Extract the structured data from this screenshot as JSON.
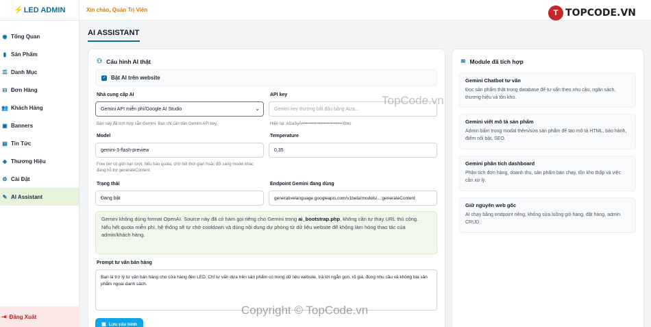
{
  "brand": {
    "bolt": "⚡",
    "name": "LED ADMIN"
  },
  "topbar": {
    "greeting": "Xin chào, Quản Trị Viên"
  },
  "logo": {
    "mark": "T",
    "text": "TOPCODE.VN"
  },
  "sidebar": {
    "items": [
      {
        "label": "Tổng Quan",
        "icon": "◉"
      },
      {
        "label": "Sản Phẩm",
        "icon": "▮"
      },
      {
        "label": "Danh Mục",
        "icon": "☰"
      },
      {
        "label": "Đơn Hàng",
        "icon": "⊟"
      },
      {
        "label": "Khách Hàng",
        "icon": "👥"
      },
      {
        "label": "Banners",
        "icon": "▣"
      },
      {
        "label": "Tin Tức",
        "icon": "▤"
      },
      {
        "label": "Thương Hiệu",
        "icon": "◈"
      },
      {
        "label": "Cài Đặt",
        "icon": "⚙"
      },
      {
        "label": "AI Assistant",
        "icon": "✎"
      }
    ],
    "logout": "Đăng Xuất"
  },
  "page": {
    "title": "AI ASSISTANT"
  },
  "config": {
    "heading": "Cấu hình AI thật",
    "enable_label": "Bật AI trên website",
    "provider": {
      "label": "Nhà cung cấp AI",
      "value": "Gemini API miễn phí/Google AI Studio",
      "hint": "Bản này đã tích hợp sẵn Gemini. Bạn chỉ cần dán Gemini API key."
    },
    "api_key": {
      "label": "API key",
      "placeholder": "Gemini key thường bắt đầu bằng Aiza...",
      "hint": "Hiện tại: AIzaSyA••••••••••••••••••••••••••••Xbks"
    },
    "model": {
      "label": "Model",
      "value": "gemini-3-flash-preview",
      "hint": "Free tier có giới hạn lượt. Nếu báo quota, chờ hết thời gian hoặc đổi sang model khác đang hỗ trợ generateContent."
    },
    "temperature": {
      "label": "Temperature",
      "value": "0,35"
    },
    "status": {
      "label": "Trạng thái",
      "value": "Đang bật"
    },
    "endpoint": {
      "label": "Endpoint Gemini đang dùng",
      "value": "generativelanguage.googleapis.com/v1beta/models/...:generateContent"
    },
    "alert": {
      "line1_pre": "Gemini không dùng format OpenAI. Source này đã có hàm gọi riêng cho Gemini trong ",
      "line1_bold": "ai_bootstrap.php",
      "line1_post": ", không cần tự thay URL thủ công.",
      "line2": "Nếu hết quota miễn phí, hệ thống sẽ tự chờ cooldown và dùng nội dung dự phòng từ dữ liệu website để không làm hỏng thao tác của admin/khách hàng."
    },
    "prompt": {
      "label": "Prompt tư vấn bán hàng",
      "value": "Bạn là trợ lý tư vấn bán hàng cho cửa hàng đèn LED. Chỉ tư vấn dựa trên sản phẩm có trong dữ liệu website, trả lời ngắn gọn, rõ giá, đúng nhu cầu và không bịa sản phẩm ngoài danh sách."
    },
    "save_label": "Lưu cấu hình"
  },
  "modules": {
    "heading": "Module đã tích hợp",
    "items": [
      {
        "title": "Gemini Chatbot tư vấn",
        "desc": "Đọc sản phẩm thật trong database để tư vấn theo nhu cầu, ngân sách, thương hiệu và tồn kho."
      },
      {
        "title": "Gemini viết mô tả sản phẩm",
        "desc": "Admin bấm trong modal thêm/sửa sản phẩm để tạo mô tả HTML, bảo hành, điểm nổi bật, SEO."
      },
      {
        "title": "Gemini phân tích dashboard",
        "desc": "Phân tích đơn hàng, doanh thu, sản phẩm bán chạy, tồn kho thấp và việc cần xử lý."
      },
      {
        "title": "Giữ nguyên web gốc",
        "desc": "AI chạy bằng endpoint riêng, không sửa luồng giỏ hàng, đặt hàng, admin CRUD."
      }
    ]
  },
  "watermark": {
    "top": "TopCode.vn",
    "bottom": "Copyright © TopCode.vn"
  }
}
